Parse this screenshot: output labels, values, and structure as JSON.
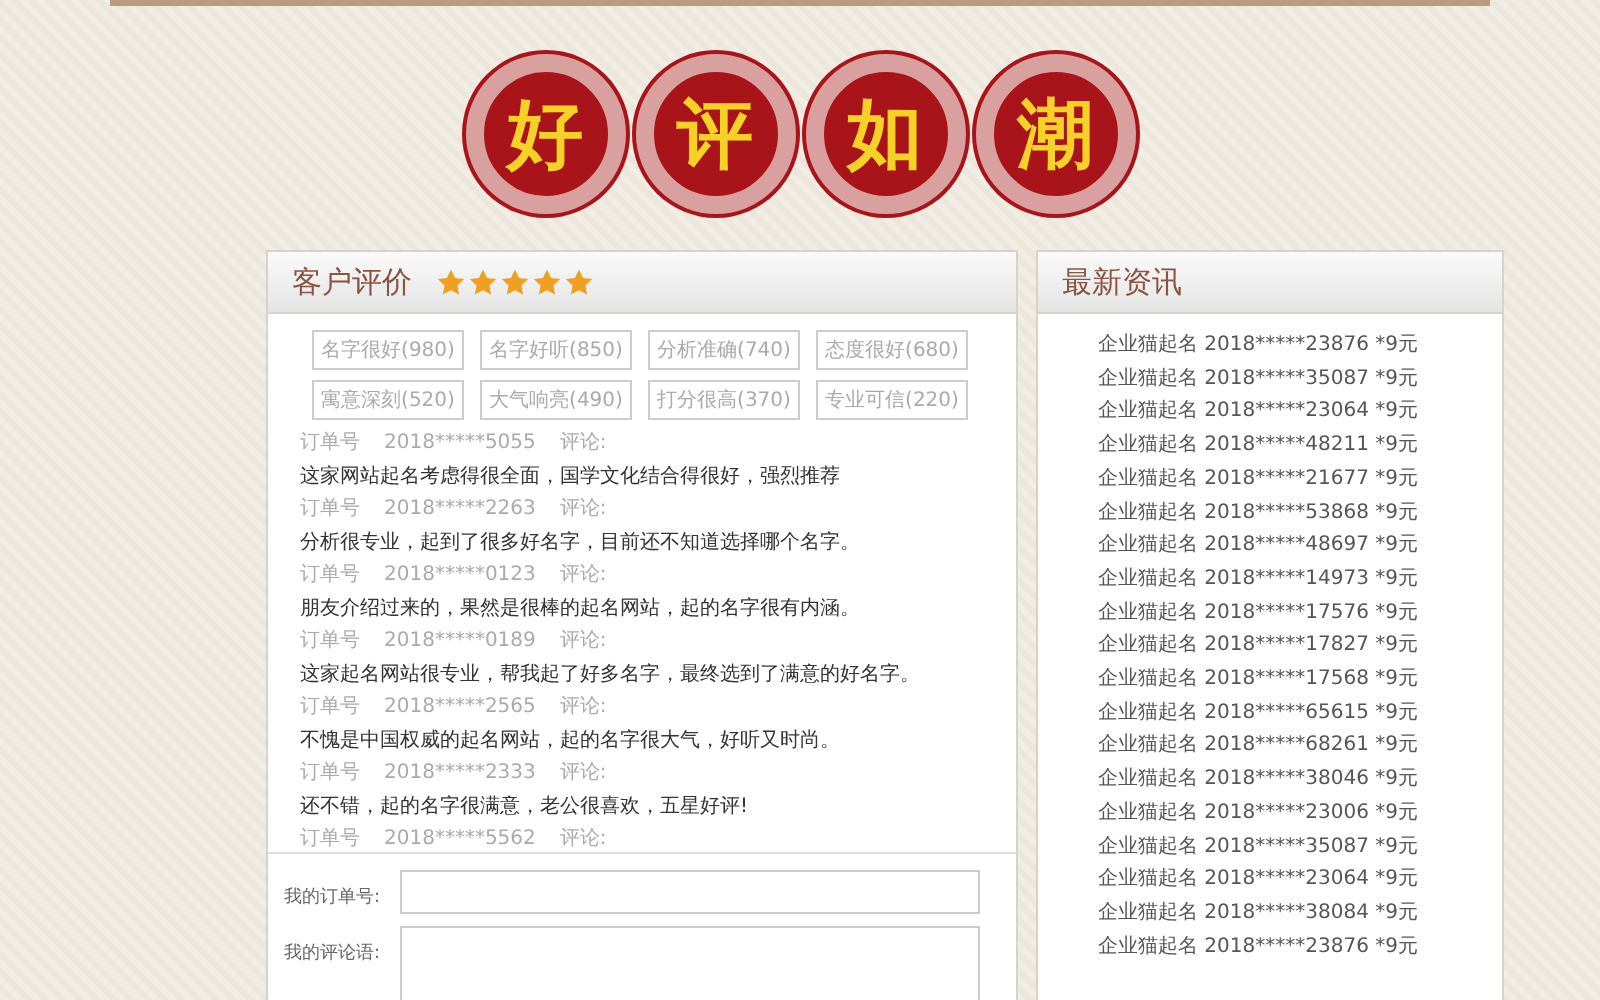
{
  "banner": {
    "characters": [
      "好",
      "评",
      "如",
      "潮"
    ]
  },
  "reviews_panel": {
    "title": "客户评价",
    "stars": 5,
    "tags": [
      "名字很好(980)",
      "名字好听(850)",
      "分析准确(740)",
      "态度很好(680)",
      "寓意深刻(520)",
      "大气响亮(490)",
      "打分很高(370)",
      "专业可信(220)"
    ],
    "reviews": [
      {
        "order_label": "订单号",
        "order_no": "2018*****5055",
        "comment_label": "评论:",
        "text": "这家网站起名考虑得很全面，国学文化结合得很好，强烈推荐"
      },
      {
        "order_label": "订单号",
        "order_no": "2018*****2263",
        "comment_label": "评论:",
        "text": "分析很专业，起到了很多好名字，目前还不知道选择哪个名字。"
      },
      {
        "order_label": "订单号",
        "order_no": "2018*****0123",
        "comment_label": "评论:",
        "text": "朋友介绍过来的，果然是很棒的起名网站，起的名字很有内涵。"
      },
      {
        "order_label": "订单号",
        "order_no": "2018*****0189",
        "comment_label": "评论:",
        "text": "这家起名网站很专业，帮我起了好多名字，最终选到了满意的好名字。"
      },
      {
        "order_label": "订单号",
        "order_no": "2018*****2565",
        "comment_label": "评论:",
        "text": "不愧是中国权威的起名网站，起的名字很大气，好听又时尚。"
      },
      {
        "order_label": "订单号",
        "order_no": "2018*****2333",
        "comment_label": "评论:",
        "text": "还不错，起的名字很满意，老公很喜欢，五星好评!"
      },
      {
        "order_label": "订单号",
        "order_no": "2018*****5562",
        "comment_label": "评论:"
      }
    ],
    "form": {
      "order_label": "我的订单号:",
      "comment_label": "我的评论语:"
    }
  },
  "news_panel": {
    "title": "最新资讯",
    "items": [
      "企业猫起名 2018*****23876 *9元",
      "企业猫起名 2018*****35087 *9元",
      "企业猫起名 2018*****23064 *9元",
      "企业猫起名 2018*****48211 *9元",
      "企业猫起名 2018*****21677 *9元",
      "企业猫起名 2018*****53868 *9元",
      "企业猫起名 2018*****48697 *9元",
      "企业猫起名 2018*****14973 *9元",
      "企业猫起名 2018*****17576 *9元",
      "企业猫起名 2018*****17827 *9元",
      "企业猫起名 2018*****17568 *9元",
      "企业猫起名 2018*****65615 *9元",
      "企业猫起名 2018*****68261 *9元",
      "企业猫起名 2018*****38046 *9元",
      "企业猫起名 2018*****23006 *9元",
      "企业猫起名 2018*****35087 *9元",
      "企业猫起名 2018*****23064 *9元",
      "企业猫起名 2018*****38084 *9元",
      "企业猫起名 2018*****23876 *9元"
    ]
  }
}
